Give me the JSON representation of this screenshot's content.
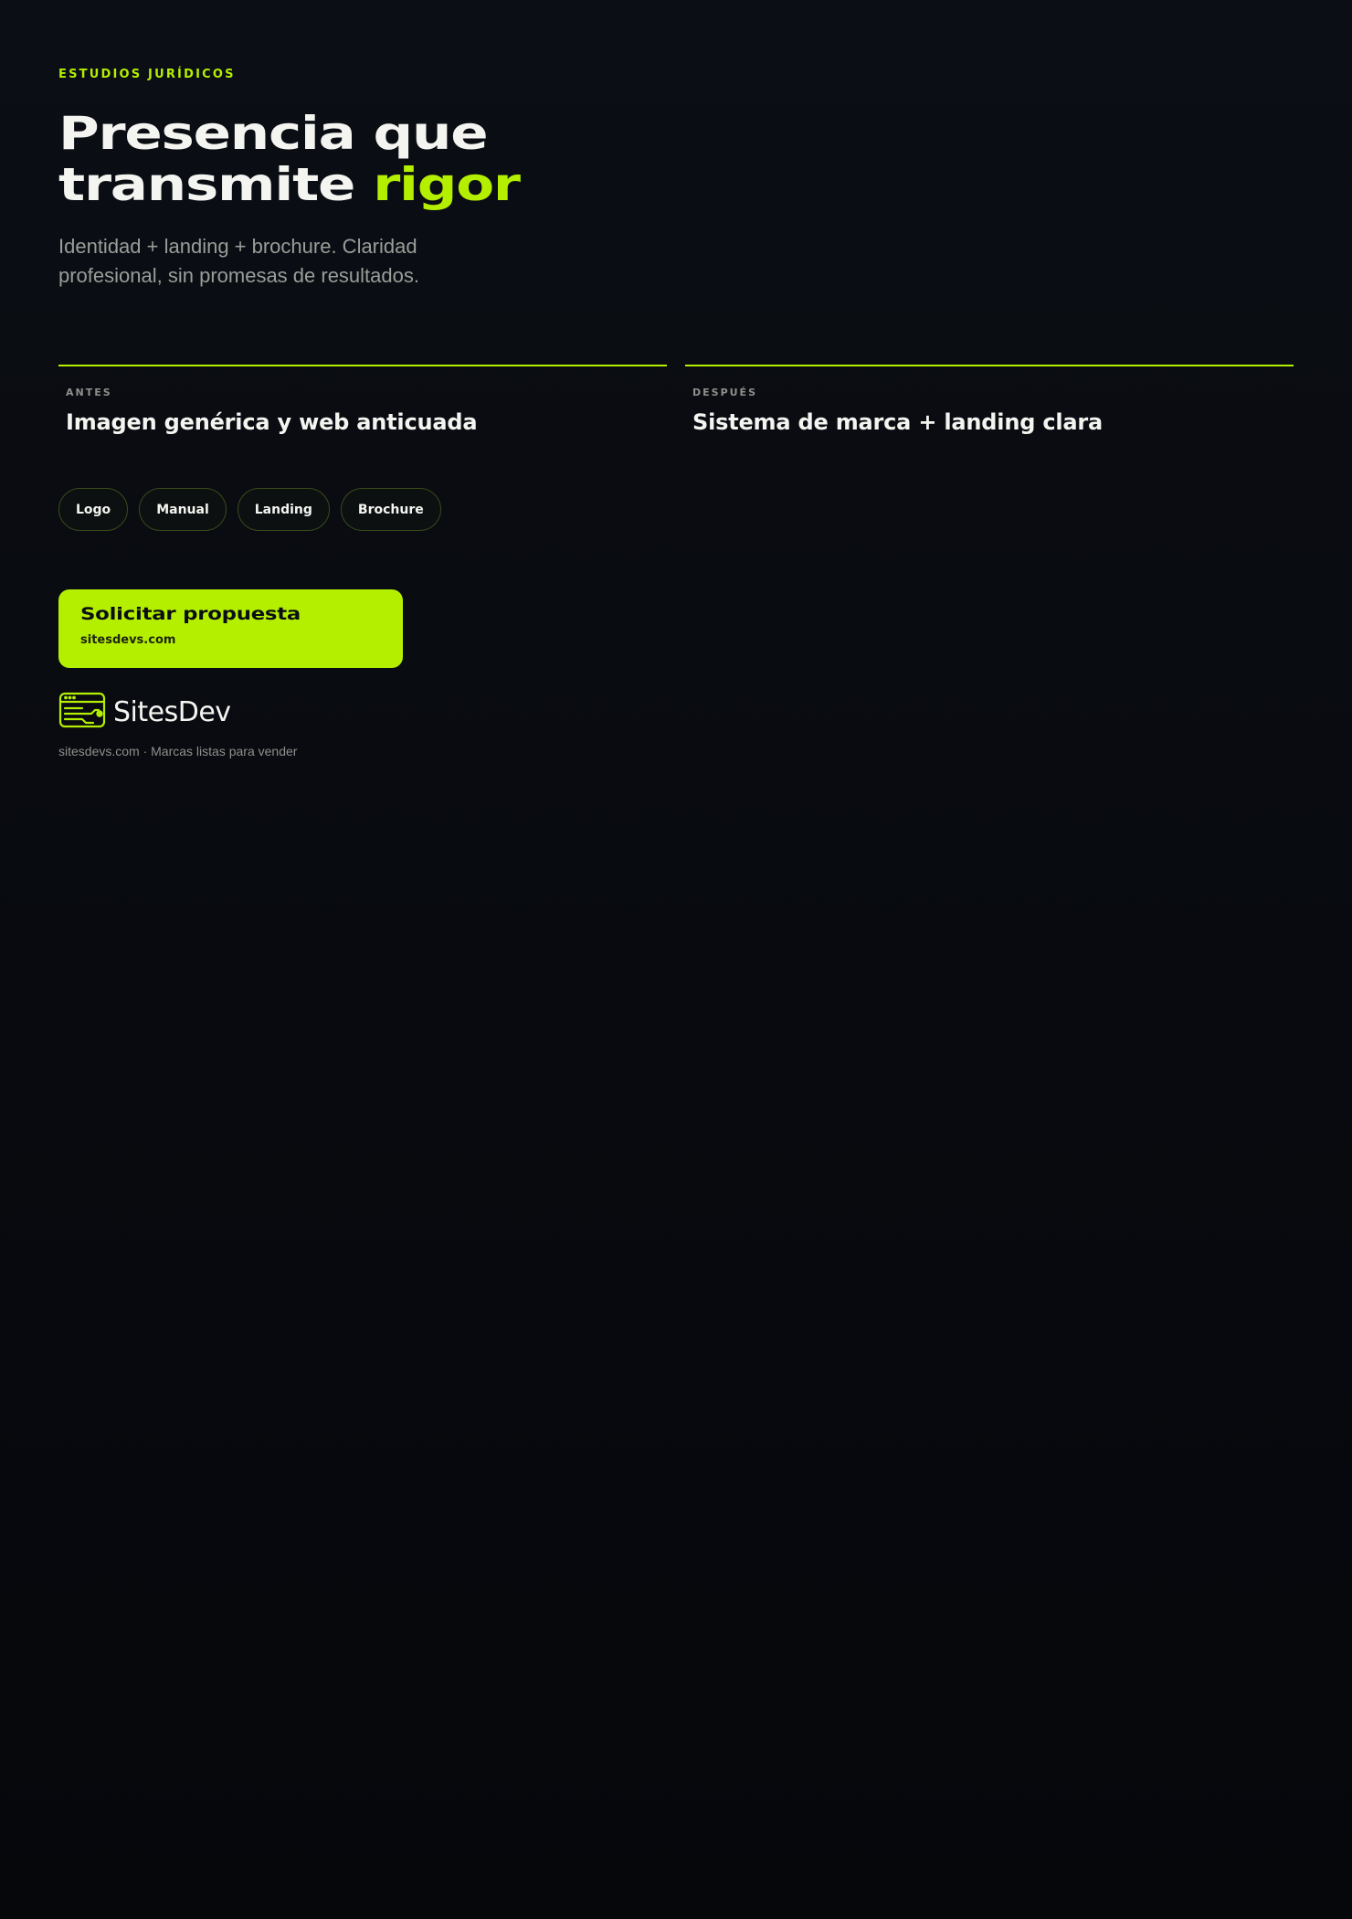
{
  "colors": {
    "accent": "#b4ef00",
    "background": "#0b0e14",
    "text": "#f4f5f0",
    "muted": "#9a9d98"
  },
  "hero": {
    "eyebrow": "ESTUDIOS JURÍDICOS",
    "title_line1": "Presencia que",
    "title_line2_plain": "transmite ",
    "title_line2_accent": "rigor",
    "subtitle": "Identidad + landing + brochure. Claridad profesional, sin promesas de resultados."
  },
  "comparison": {
    "before": {
      "label": "ANTES",
      "text": "Imagen genérica y web anticuada"
    },
    "after": {
      "label": "DESPUÉS",
      "text": "Sistema de marca + landing clara"
    }
  },
  "tags": [
    "Logo",
    "Manual",
    "Landing",
    "Brochure"
  ],
  "cta": {
    "title": "Solicitar propuesta",
    "url": "sitesdevs.com"
  },
  "brand": {
    "name": "SitesDev",
    "icon": "browser-circuit-icon",
    "footnote": "sitesdevs.com · Marcas listas para vender"
  }
}
